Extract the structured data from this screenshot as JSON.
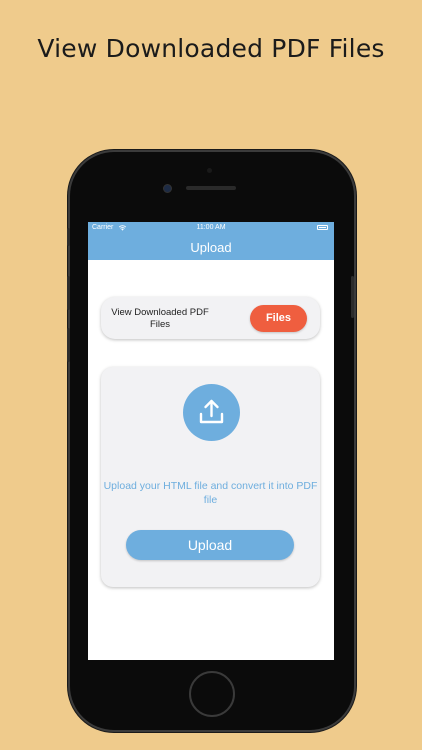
{
  "headline": "View Downloaded PDF Files",
  "status_bar": {
    "carrier": "Carrier",
    "time": "11:00 AM"
  },
  "nav": {
    "title": "Upload"
  },
  "files_card": {
    "text": "View Downloaded PDF Files",
    "button_label": "Files"
  },
  "upload_card": {
    "description": "Upload your HTML file and convert it into PDF file",
    "button_label": "Upload",
    "icon": "upload-icon"
  },
  "colors": {
    "background": "#EFCB8C",
    "accent_blue": "#6EAEDE",
    "files_button": "#EF5E3F",
    "card": "#F2F2F4"
  }
}
